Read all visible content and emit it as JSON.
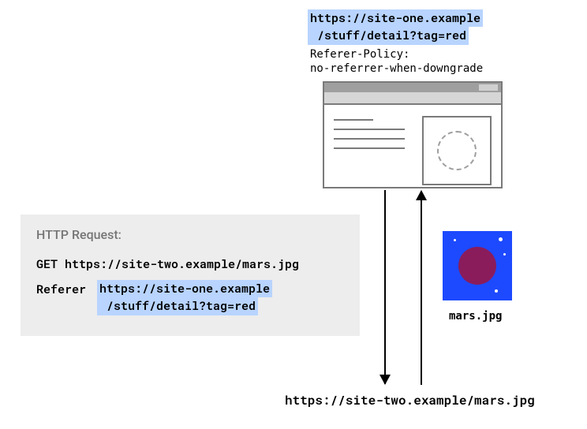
{
  "topUrl": {
    "line1": "https://site-one.example",
    "line2": " /stuff/detail?tag=red"
  },
  "refererPolicy": {
    "header": "Referer-Policy:",
    "value": "no-referrer-when-downgrade"
  },
  "httpRequest": {
    "title": "HTTP Request:",
    "getLine": "GET https://site-two.example/mars.jpg",
    "refererLabel": "Referer",
    "refererValue": {
      "line1": "https://site-one.example",
      "line2": " /stuff/detail?tag=red"
    }
  },
  "mars": {
    "filename": "mars.jpg"
  },
  "bottomUrl": "https://site-two.example/mars.jpg"
}
